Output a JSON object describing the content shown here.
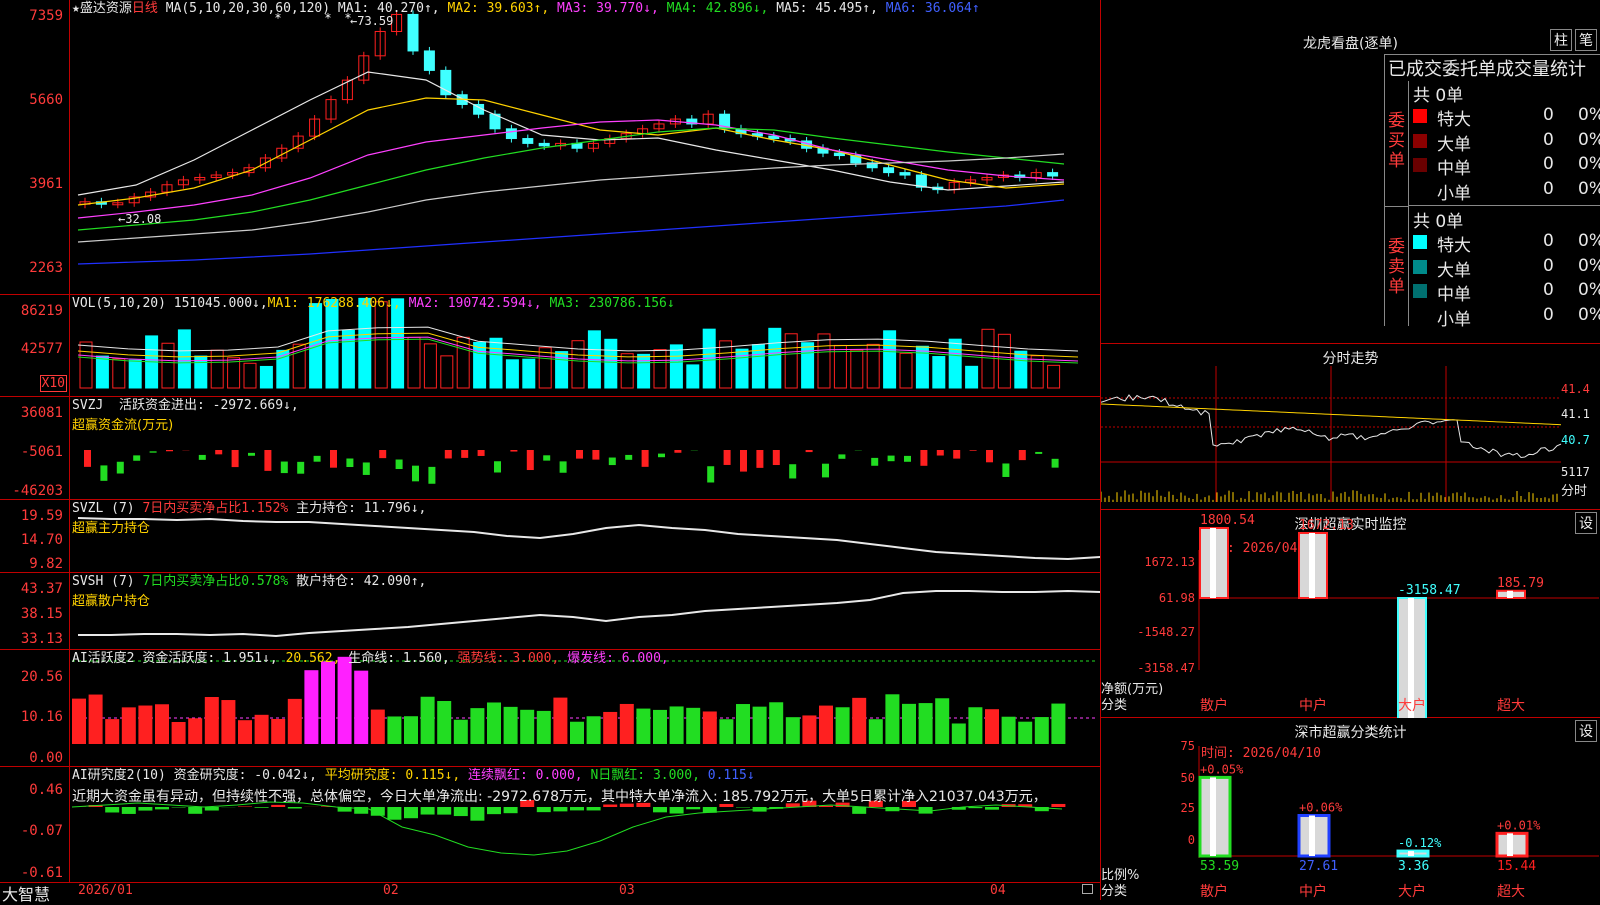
{
  "main_chart": {
    "stock_name": "盛达资源",
    "period": "日线",
    "ma_label": "MA(5,10,20,30,60,120)",
    "ma": [
      {
        "name": "MA1:",
        "value": "40.270↑,",
        "color": "#e8e8e8"
      },
      {
        "name": "MA2:",
        "value": "39.603↑,",
        "color": "#ffd200"
      },
      {
        "name": "MA3:",
        "value": "39.770↓,",
        "color": "#ff40ff"
      },
      {
        "name": "MA4:",
        "value": "42.896↓,",
        "color": "#22dd22"
      },
      {
        "name": "MA5:",
        "value": "45.495↑,",
        "color": "#e8e8e8"
      },
      {
        "name": "MA6:",
        "value": "36.064↑",
        "color": "#4060ff"
      }
    ],
    "ticks": [
      "7359",
      "5660",
      "3961",
      "2263"
    ],
    "high_label": "73.59",
    "low_label": "32.08"
  },
  "vol": {
    "header": "VOL(5,10,20)",
    "value": "151045.000↓,",
    "ma1": "MA1: 176288.406↓,",
    "ma2": "MA2: 190742.594↓,",
    "ma3": "MA3: 230786.156↓",
    "ticks": [
      "86219",
      "42577"
    ],
    "unit": "X10"
  },
  "svzj": {
    "header": "SVZJ",
    "text": "活跃资金进出: -2972.669↓,",
    "sub": "超赢资金流(万元)",
    "ticks": [
      "36081",
      "-5061",
      "-46203"
    ]
  },
  "svzl": {
    "header": "SVZL (7)",
    "text1": "7日内买卖净占比1.152%",
    "text2": "主力持仓: 11.796↓,",
    "sub": "超赢主力持仓",
    "ticks": [
      "19.59",
      "14.70",
      "9.82"
    ]
  },
  "svsh": {
    "header": "SVSH (7)",
    "text1": "7日内买卖净占比0.578%",
    "text2": "散户持仓: 42.090↑,",
    "sub": "超赢散户持仓",
    "ticks": [
      "43.37",
      "38.15",
      "33.13"
    ]
  },
  "ai_active": {
    "header": "AI活跃度2",
    "t1": "资金活跃度: 1.951↓,",
    "t2": "20.562,",
    "t3": "生命线: 1.560,",
    "t4": "强势线: 3.000,",
    "t5": "爆发线: 6.000,",
    "ticks": [
      "20.56",
      "10.16",
      "0.00"
    ]
  },
  "ai_research": {
    "header": "AI研究度2(10)",
    "t1": "资金研究度: -0.042↓,",
    "t2": "平均研究度: 0.115↓,",
    "t3": "连续飘红: 0.000,",
    "t4": "N日飘红: 3.000,",
    "t5": "0.115↓",
    "comment": "近期大资金虽有异动，但持续性不强，总体偏空，今日大单净流出: -2972.678万元，其中特大单净流入: 185.792万元，大单5日累计净入21037.043万元，",
    "ticks": [
      "0.46",
      "-0.07",
      "-0.61"
    ]
  },
  "footer": {
    "brand": "大智慧",
    "dates": [
      "2026/01",
      "02",
      "03",
      "04"
    ]
  },
  "dragon_tiger": {
    "title": "龙虎看盘(逐单)",
    "btn1": "柱",
    "btn2": "笔",
    "subtitle": "已成交委托单成交量统计",
    "buy_label": "委买单",
    "sell_label": "委卖单",
    "buy_total": "共 0单",
    "sell_total": "共 0单",
    "buy_rows": [
      {
        "name": "特大",
        "count": "0",
        "pct": "0%",
        "color": "#ff0000"
      },
      {
        "name": "大单",
        "count": "0",
        "pct": "0%",
        "color": "#8b0000"
      },
      {
        "name": "中单",
        "count": "0",
        "pct": "0%",
        "color": "#6a0000"
      },
      {
        "name": "小单",
        "count": "0",
        "pct": "0%",
        "color": "#000000"
      }
    ],
    "sell_rows": [
      {
        "name": "特大",
        "count": "0",
        "pct": "0%",
        "color": "#00ffff"
      },
      {
        "name": "大单",
        "count": "0",
        "pct": "0%",
        "color": "#008b8b"
      },
      {
        "name": "中单",
        "count": "0",
        "pct": "0%",
        "color": "#007070"
      },
      {
        "name": "小单",
        "count": "0",
        "pct": "0%",
        "color": "#000000"
      }
    ]
  },
  "intraday": {
    "title": "分时走势",
    "ticks": [
      "41.4",
      "41.1",
      "40.7"
    ],
    "vol_tick": "5117",
    "unit": "分时"
  },
  "sz_monitor": {
    "title": "深圳超赢实时监控",
    "btn": "设",
    "time": "时间: 2026/04/10",
    "ticks": [
      "1672.13",
      "61.98",
      "-1548.27",
      "-3158.47"
    ],
    "ylabel": "净额(万元)",
    "xlabel": "分类",
    "bars": [
      {
        "name": "散户",
        "label": "1800.54",
        "value": 1800.54
      },
      {
        "name": "中户",
        "label": "1672.13",
        "value": 1672.13
      },
      {
        "name": "大户",
        "label": "-3158.47",
        "value": -3158.47
      },
      {
        "name": "超大",
        "label": "185.79",
        "value": 185.79
      }
    ]
  },
  "sz_class": {
    "title": "深市超赢分类统计",
    "btn": "设",
    "time": "时间: 2026/04/10",
    "ticks": [
      "75",
      "50",
      "25",
      "0"
    ],
    "ylabel": "比例%",
    "xlabel": "分类",
    "bars": [
      {
        "name": "散户",
        "value": 53.59,
        "top": "+0.05%",
        "bottom": "53.59",
        "color": "#22dd22"
      },
      {
        "name": "中户",
        "value": 27.61,
        "top": "+0.06%",
        "bottom": "27.61",
        "color": "#2040ff"
      },
      {
        "name": "大户",
        "value": 3.36,
        "top": "-0.12%",
        "bottom": "3.36",
        "color": "#40ffff"
      },
      {
        "name": "超大",
        "value": 15.44,
        "top": "+0.01%",
        "bottom": "15.44",
        "color": "#ff2020"
      }
    ]
  }
}
